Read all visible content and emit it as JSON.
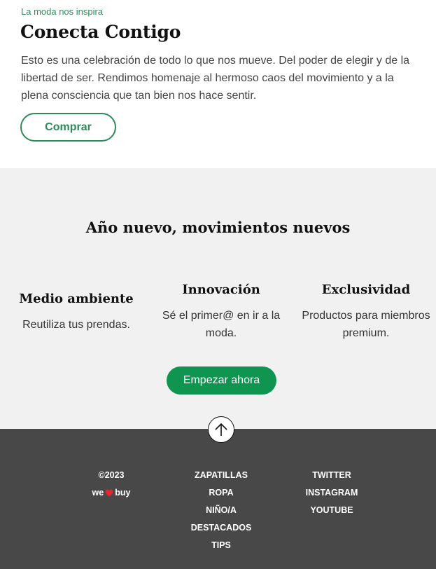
{
  "hero": {
    "eyebrow": "La moda nos inspira",
    "title": "Conecta Contigo",
    "body": "Esto es una celebración de todo lo que nos mueve. Del poder de elegir y de la libertad de ser. Rendimos homenaje al hermoso caos del movimiento y a la plena consciencia que tan bien nos hace sentir.",
    "button": "Comprar"
  },
  "features": {
    "title": "Año nuevo, movimientos nuevos",
    "items": [
      {
        "title": "Medio ambiente",
        "text": "Reutiliza tus prendas."
      },
      {
        "title": "Innovación",
        "text": "Sé el primer@ en ir a la moda."
      },
      {
        "title": "Exclusividad",
        "text": "Productos para miembros premium."
      }
    ],
    "button": "Empezar ahora"
  },
  "footer": {
    "copyright": "©2023",
    "brand_we": "we",
    "brand_buy": "buy",
    "heart_icon": "heart-icon",
    "heart_color": "#e5262b",
    "links_shop": [
      "ZAPATILLAS",
      "ROPA",
      "NIÑO/A",
      "DESTACADOS",
      "TIPS"
    ],
    "links_social": [
      "TWITTER",
      "INSTAGRAM",
      "YOUTUBE"
    ]
  },
  "colors": {
    "accent": "#2e8b57",
    "button_fill": "#0f9550",
    "section_bg": "#f1f1f1",
    "footer_bg": "#484848"
  }
}
